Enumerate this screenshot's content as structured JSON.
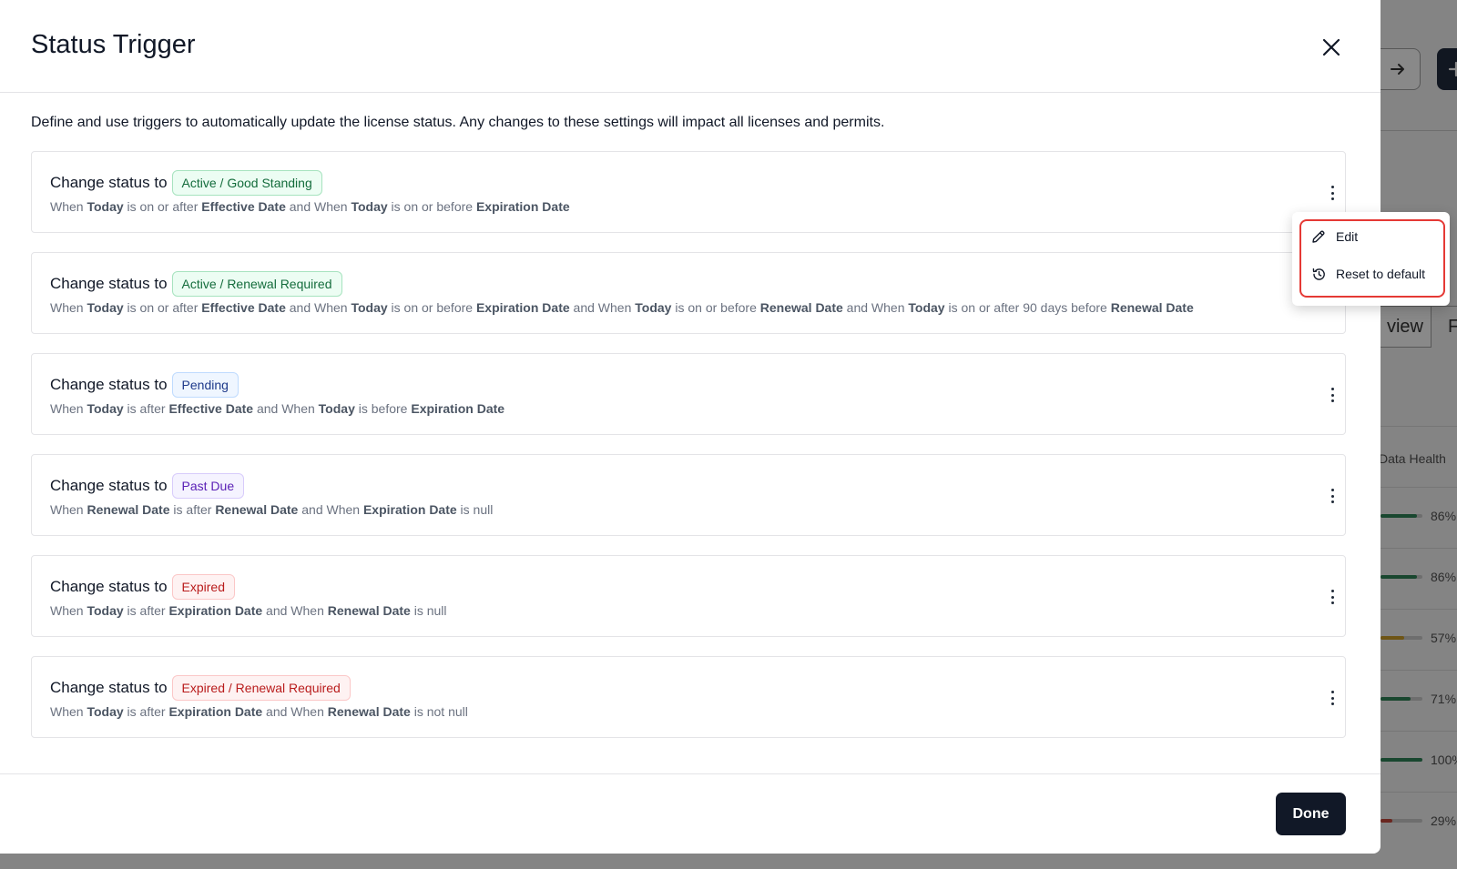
{
  "background": {
    "column_label": "Data Health",
    "tab_label": "view",
    "tab2_label": "F",
    "rows": [
      {
        "percent": "86%",
        "fill": 0.86,
        "color": "#1f7a4a"
      },
      {
        "percent": "86%",
        "fill": 0.86,
        "color": "#1f7a4a"
      },
      {
        "percent": "57%",
        "fill": 0.57,
        "color": "#c99716"
      },
      {
        "percent": "71%",
        "fill": 0.71,
        "color": "#1f7a4a"
      },
      {
        "percent": "100%",
        "fill": 1.0,
        "color": "#1f7a4a"
      },
      {
        "percent": "29%",
        "fill": 0.29,
        "color": "#c0392b"
      }
    ]
  },
  "modal": {
    "title": "Status Trigger",
    "description": "Define and use triggers to automatically update the license status. Any changes to these settings will impact all licenses and permits.",
    "change_prefix": "Change status to",
    "done_label": "Done"
  },
  "triggers": [
    {
      "status": "Active / Good Standing",
      "badge_color": "green",
      "condition": [
        [
          "When ",
          "n"
        ],
        [
          "Today",
          "b"
        ],
        [
          " is on or after ",
          "n"
        ],
        [
          "Effective Date",
          "b"
        ],
        [
          " and When ",
          "n"
        ],
        [
          "Today",
          "b"
        ],
        [
          " is on or before ",
          "n"
        ],
        [
          "Expiration Date",
          "b"
        ]
      ]
    },
    {
      "status": "Active / Renewal Required",
      "badge_color": "green",
      "condition": [
        [
          "When ",
          "n"
        ],
        [
          "Today",
          "b"
        ],
        [
          " is on or after ",
          "n"
        ],
        [
          "Effective Date",
          "b"
        ],
        [
          " and When ",
          "n"
        ],
        [
          "Today",
          "b"
        ],
        [
          " is on or before ",
          "n"
        ],
        [
          "Expiration Date",
          "b"
        ],
        [
          " and When ",
          "n"
        ],
        [
          "Today",
          "b"
        ],
        [
          " is on or before ",
          "n"
        ],
        [
          "Renewal Date",
          "b"
        ],
        [
          " and When ",
          "n"
        ],
        [
          "Today",
          "b"
        ],
        [
          " is on or after 90 days before ",
          "n"
        ],
        [
          "Renewal Date",
          "b"
        ]
      ]
    },
    {
      "status": "Pending",
      "badge_color": "blue",
      "condition": [
        [
          "When ",
          "n"
        ],
        [
          "Today",
          "b"
        ],
        [
          " is after ",
          "n"
        ],
        [
          "Effective Date",
          "b"
        ],
        [
          " and When ",
          "n"
        ],
        [
          "Today",
          "b"
        ],
        [
          " is before ",
          "n"
        ],
        [
          "Expiration Date",
          "b"
        ]
      ]
    },
    {
      "status": "Past Due",
      "badge_color": "purple",
      "condition": [
        [
          "When ",
          "n"
        ],
        [
          "Renewal Date",
          "b"
        ],
        [
          " is after ",
          "n"
        ],
        [
          "Renewal Date",
          "b"
        ],
        [
          " and When ",
          "n"
        ],
        [
          "Expiration Date",
          "b"
        ],
        [
          " is null",
          "n"
        ]
      ]
    },
    {
      "status": "Expired",
      "badge_color": "red",
      "condition": [
        [
          "When ",
          "n"
        ],
        [
          "Today",
          "b"
        ],
        [
          " is after ",
          "n"
        ],
        [
          "Expiration Date",
          "b"
        ],
        [
          " and When ",
          "n"
        ],
        [
          "Renewal Date",
          "b"
        ],
        [
          " is null",
          "n"
        ]
      ]
    },
    {
      "status": "Expired / Renewal Required",
      "badge_color": "red",
      "condition": [
        [
          "When ",
          "n"
        ],
        [
          "Today",
          "b"
        ],
        [
          " is after ",
          "n"
        ],
        [
          "Expiration Date",
          "b"
        ],
        [
          " and When ",
          "n"
        ],
        [
          "Renewal Date",
          "b"
        ],
        [
          " is not null",
          "n"
        ]
      ]
    }
  ],
  "badge_styles": {
    "green": {
      "bg": "#ecfdf3",
      "border": "#a7e3bf",
      "text": "#146c3c"
    },
    "blue": {
      "bg": "#eff6ff",
      "border": "#bfdbfe",
      "text": "#1e3a8a"
    },
    "purple": {
      "bg": "#f5f3ff",
      "border": "#d8ccfb",
      "text": "#5b21b6"
    },
    "red": {
      "bg": "#fef2f2",
      "border": "#fbc7c7",
      "text": "#b91c1c"
    }
  },
  "menu": {
    "items": [
      {
        "label": "Edit",
        "icon": "pencil-icon"
      },
      {
        "label": "Reset to default",
        "icon": "reset-icon"
      }
    ],
    "highlight_color": "#e53935"
  }
}
